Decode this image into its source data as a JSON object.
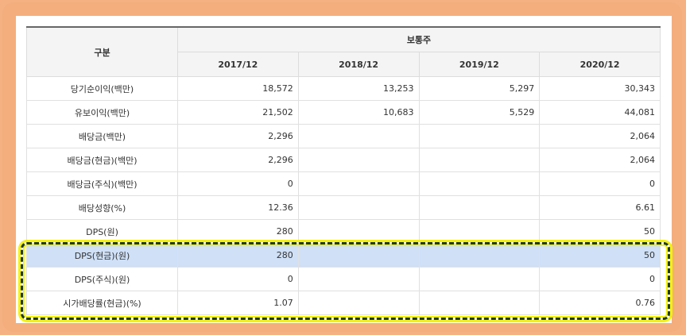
{
  "header": {
    "category": "구분",
    "group": "보통주",
    "years": [
      "2017/12",
      "2018/12",
      "2019/12",
      "2020/12"
    ]
  },
  "rows": [
    {
      "label": "당기순이익(백만)",
      "values": [
        "18,572",
        "13,253",
        "5,297",
        "30,343"
      ],
      "highlighted": false
    },
    {
      "label": "유보이익(백만)",
      "values": [
        "21,502",
        "10,683",
        "5,529",
        "44,081"
      ],
      "highlighted": false
    },
    {
      "label": "배당금(백만)",
      "values": [
        "2,296",
        "",
        "",
        "2,064"
      ],
      "highlighted": false
    },
    {
      "label": "배당금(현금)(백만)",
      "values": [
        "2,296",
        "",
        "",
        "2,064"
      ],
      "highlighted": false
    },
    {
      "label": "배당금(주식)(백만)",
      "values": [
        "0",
        "",
        "",
        "0"
      ],
      "highlighted": false
    },
    {
      "label": "배당성향(%)",
      "values": [
        "12.36",
        "",
        "",
        "6.61"
      ],
      "highlighted": false
    },
    {
      "label": "DPS(원)",
      "values": [
        "280",
        "",
        "",
        "50"
      ],
      "highlighted": false
    },
    {
      "label": "DPS(현금)(원)",
      "values": [
        "280",
        "",
        "",
        "50"
      ],
      "highlighted": true
    },
    {
      "label": "DPS(주식)(원)",
      "values": [
        "0",
        "",
        "",
        "0"
      ],
      "highlighted": false
    },
    {
      "label": "시가배당률(현금)(%)",
      "values": [
        "1.07",
        "",
        "",
        "0.76"
      ],
      "highlighted": false
    }
  ],
  "colors": {
    "background": "#f5b182",
    "highlight_row": "#cfe0f7",
    "dash_border": "#1e3a28",
    "glow": "#f5f20a"
  }
}
